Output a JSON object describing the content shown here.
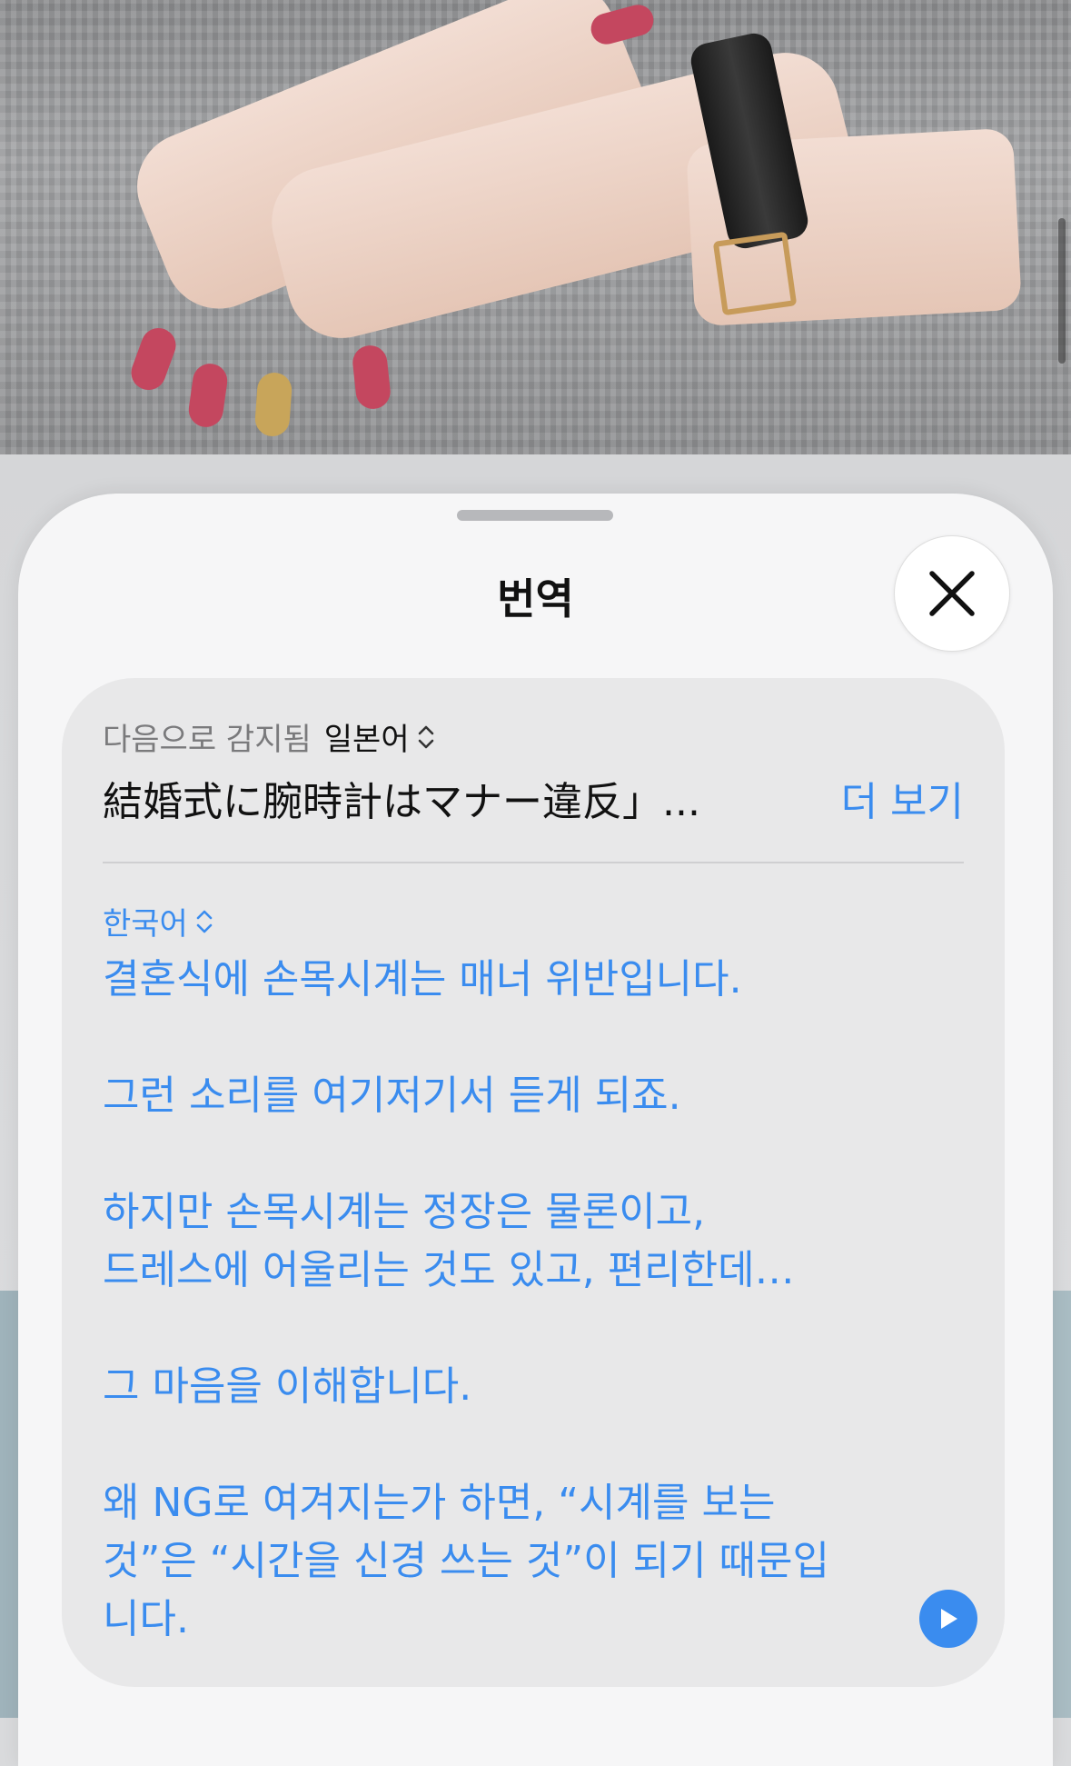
{
  "sheet": {
    "title": "번역",
    "close_icon": "close-icon"
  },
  "source": {
    "detected_label": "다음으로 감지됨",
    "language": "일본어",
    "text": "結婚式に腕時計はマナー違反」...",
    "more_label": "더 보기"
  },
  "target": {
    "language": "한국어",
    "paragraphs": [
      "결혼식에 손목시계는 매너 위반입니다.",
      "그런 소리를 여기저기서 듣게 되죠.",
      "하지만 손목시계는 정장은 물론이고,\n드레스에 어울리는 것도 있고, 편리한데…",
      "그 마음을 이해합니다.",
      "왜 NG로 여겨지는가 하면, “시계를 보는 것”은 “시간을 신경 쓰는 것”이 되기 때문입니다."
    ]
  },
  "colors": {
    "accent": "#3a8cef",
    "sheet_bg": "#f6f6f7",
    "card_bg": "#e8e8e9"
  }
}
